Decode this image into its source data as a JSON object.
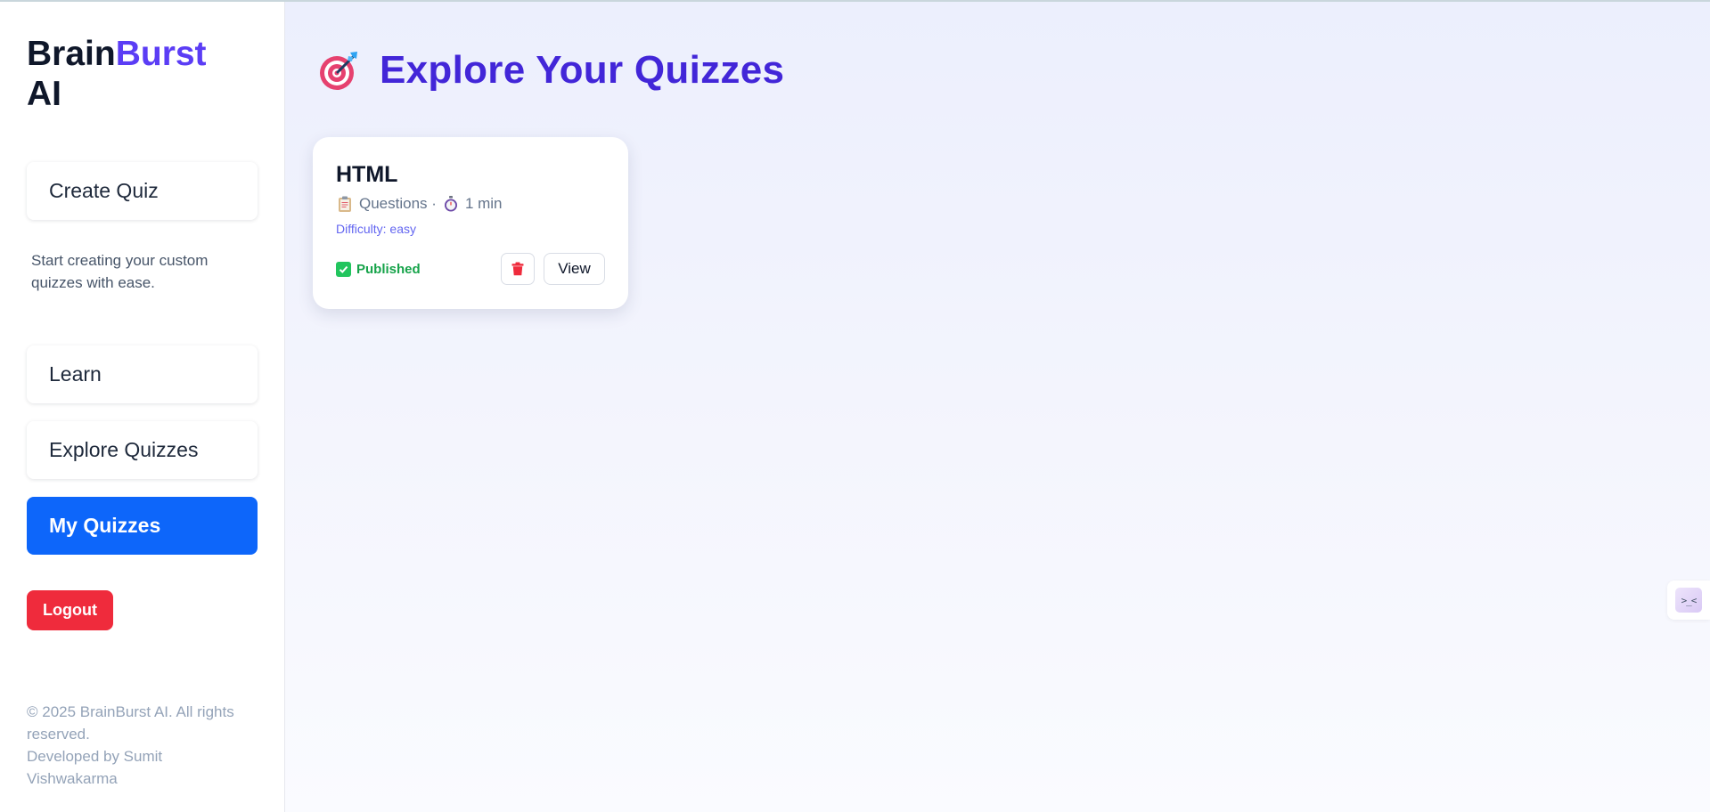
{
  "brand": {
    "part1": "Brain",
    "part2": "Burst",
    "line2": "AI",
    "accent_color": "#5b3df5"
  },
  "sidebar": {
    "create_label": "Create Quiz",
    "create_desc": "Start creating your custom quizzes with ease.",
    "items": [
      {
        "label": "Learn",
        "active": false
      },
      {
        "label": "Explore Quizzes",
        "active": false
      },
      {
        "label": "My Quizzes",
        "active": true
      }
    ],
    "logout_label": "Logout",
    "footer_line1": "© 2025 BrainBurst AI. All rights reserved.",
    "footer_line2": "Developed by Sumit Vishwakarma",
    "active_color": "#0d66fa",
    "logout_color": "#ef2b3c"
  },
  "main": {
    "title_icon": "target-icon",
    "title": "Explore Your Quizzes",
    "quizzes": [
      {
        "title": "HTML",
        "questions_label": "Questions ·",
        "duration": "1 min",
        "difficulty": "Difficulty: easy",
        "status": "Published",
        "view_label": "View"
      }
    ]
  },
  "widget": {
    "face": ">_<"
  }
}
